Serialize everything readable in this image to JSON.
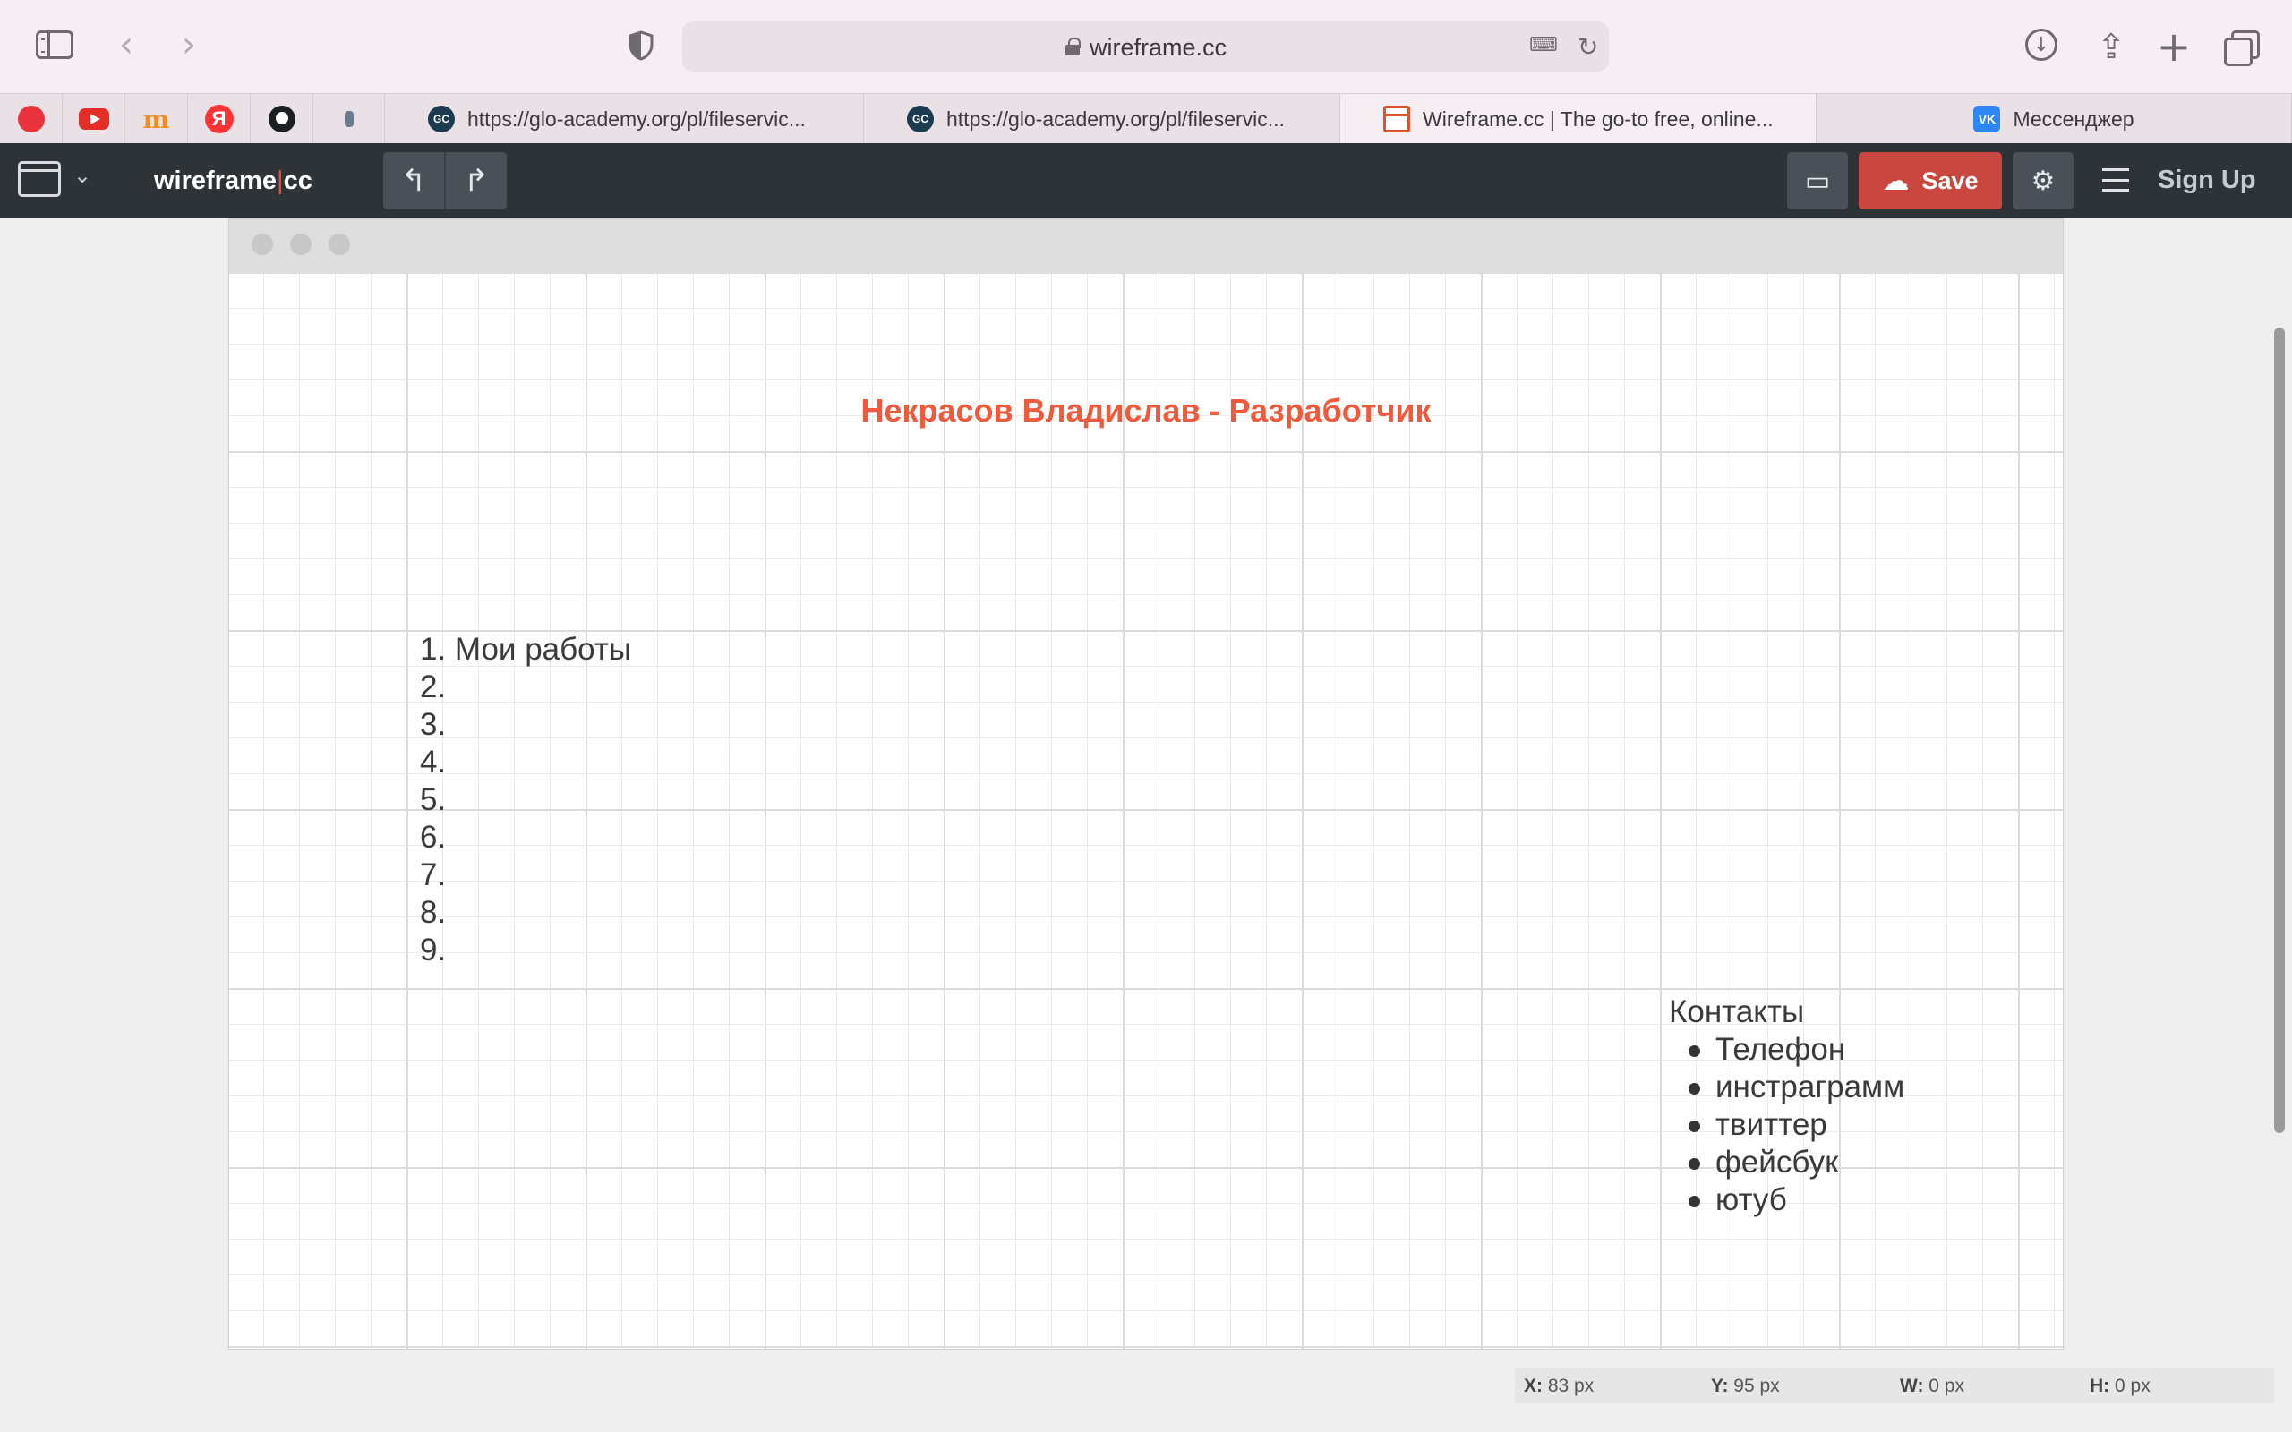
{
  "browser": {
    "url": "wireframe.cc",
    "tabs": [
      {
        "title": "https://glo-academy.org/pl/fileservic...",
        "icon": "gc-favicon",
        "icon_text": "GC"
      },
      {
        "title": "https://glo-academy.org/pl/fileservic...",
        "icon": "gc-favicon",
        "icon_text": "GC"
      },
      {
        "title": "Wireframe.cc | The go-to free, online...",
        "icon": "wireframe-favicon",
        "active": true
      },
      {
        "title": "Мессенджер",
        "icon": "vk-favicon",
        "icon_text": "VK"
      }
    ],
    "pinned": [
      {
        "name": "record",
        "icon": "red-circle-icon"
      },
      {
        "name": "youtube",
        "icon": "youtube-icon"
      },
      {
        "name": "m",
        "icon": "m-icon",
        "text": "m"
      },
      {
        "name": "yandex",
        "icon": "yandex-icon",
        "text": "Я"
      },
      {
        "name": "github",
        "icon": "github-icon"
      },
      {
        "name": "extension",
        "icon": "small-icon"
      }
    ]
  },
  "app": {
    "logo_left": "wireframe",
    "logo_sep": "|",
    "logo_right": "cc",
    "save_label": "Save",
    "signup_label": "Sign Up",
    "accent_color": "#c9473e",
    "header_color": "#2e3338"
  },
  "canvas": {
    "title": "Некрасов Владислав - Разработчик",
    "title_color": "#f05a3c",
    "works": [
      "1. Мои работы",
      "2.",
      "3.",
      "4.",
      "5.",
      "6.",
      "7.",
      "8.",
      "9."
    ],
    "contacts_title": "Контакты",
    "contacts": [
      "Телефон",
      "инстраграмм",
      "твиттер",
      "фейсбук",
      "ютуб"
    ]
  },
  "status": {
    "x_label": "X:",
    "x_value": "83 px",
    "y_label": "Y:",
    "y_value": "95 px",
    "w_label": "W:",
    "w_value": "0 px",
    "h_label": "H:",
    "h_value": "0 px"
  }
}
